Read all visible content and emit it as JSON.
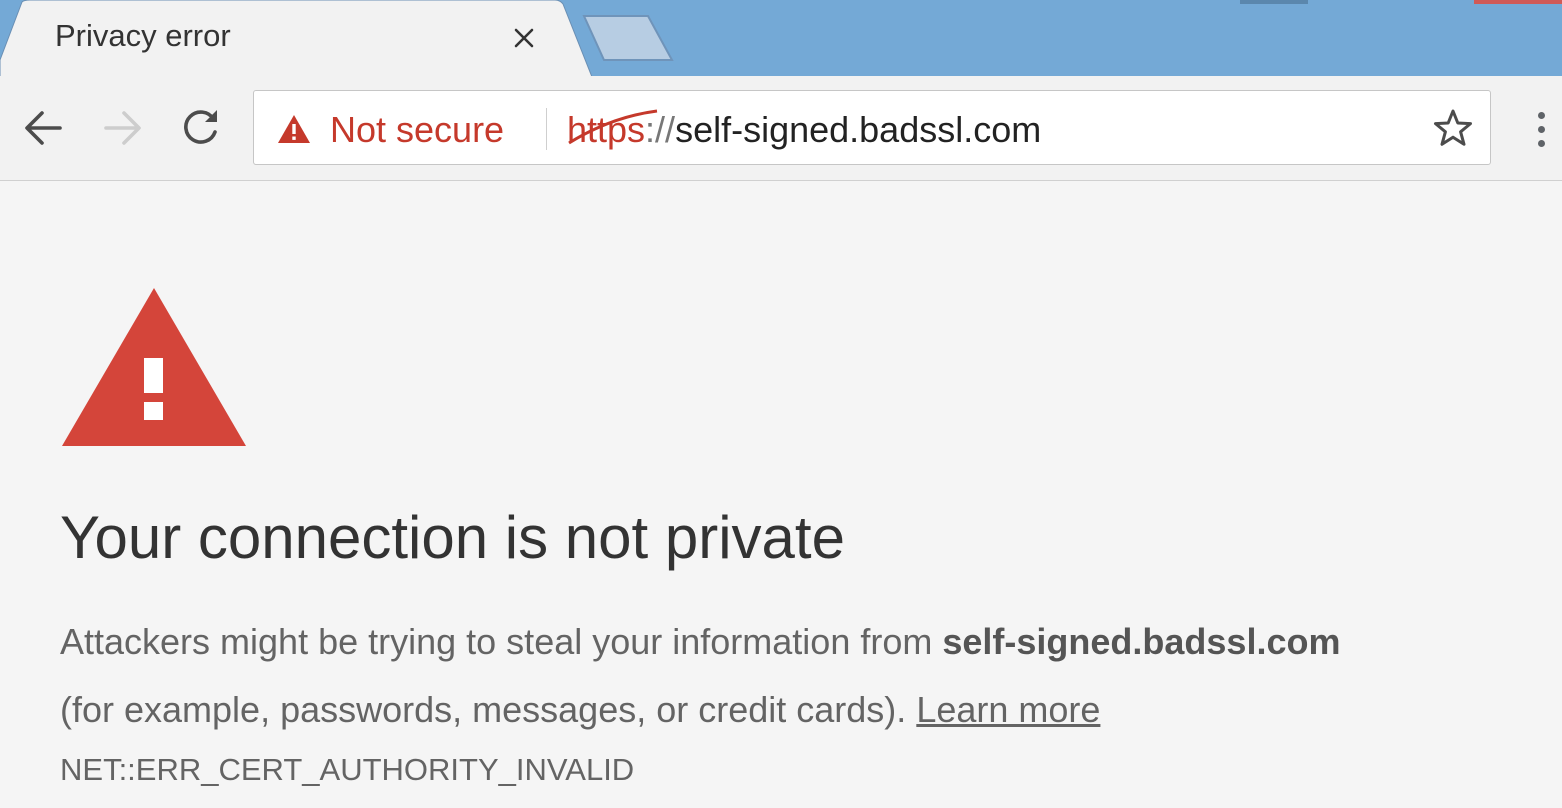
{
  "tab": {
    "title": "Privacy error",
    "close_icon": "close-icon",
    "new_tab_icon": "new-tab-icon"
  },
  "toolbar": {
    "back_icon": "arrow-back-icon",
    "forward_icon": "arrow-forward-icon",
    "reload_icon": "reload-icon",
    "bookmark_icon": "star-icon",
    "menu_icon": "more-vert-icon"
  },
  "omnibox": {
    "security_label": "Not secure",
    "security_icon": "warning-triangle-icon",
    "url_scheme": "https",
    "url_scheme_sep": "://",
    "url_host": "self-signed.badssl.com"
  },
  "interstitial": {
    "icon": "warning-triangle-icon",
    "heading": "Your connection is not private",
    "explanation_prefix": "Attackers might be trying to steal your information from ",
    "site": "self-signed.badssl.com",
    "explanation_suffix": "(for example, passwords, messages, or credit cards). ",
    "learn_more": "Learn more",
    "error_code": "NET::ERR_CERT_AUTHORITY_INVALID"
  },
  "colors": {
    "tabstrip": "#74a9d6",
    "warning_red": "#d4453a",
    "not_secure_text": "#c5392b",
    "page_background": "#f5f5f5"
  }
}
